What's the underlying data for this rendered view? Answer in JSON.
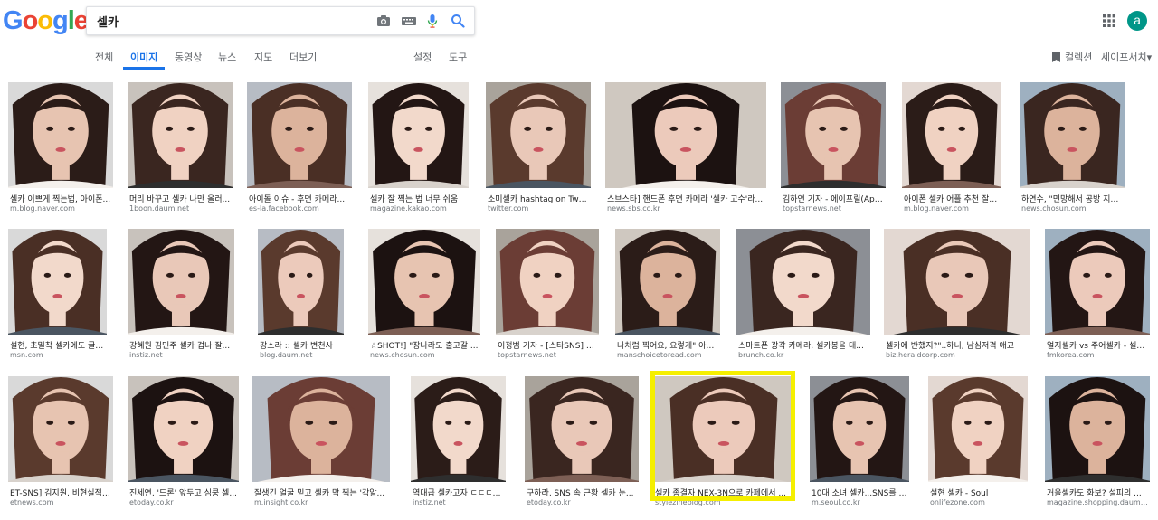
{
  "logo": {
    "letters": [
      "G",
      "o",
      "o",
      "g",
      "l",
      "e"
    ],
    "colors": [
      "#4285f4",
      "#ea4335",
      "#fbbc05",
      "#4285f4",
      "#34a853",
      "#ea4335"
    ]
  },
  "search": {
    "query": "셀카"
  },
  "tabs": [
    {
      "label": "전체",
      "active": false
    },
    {
      "label": "이미지",
      "active": true
    },
    {
      "label": "동영상",
      "active": false
    },
    {
      "label": "뉴스",
      "active": false
    },
    {
      "label": "지도",
      "active": false
    },
    {
      "label": "더보기",
      "active": false
    },
    {
      "label": "설정",
      "active": false
    },
    {
      "label": "도구",
      "active": false
    }
  ],
  "right": {
    "collections": "컬렉션",
    "safesearch": "세이프서치▾",
    "avatar": "a"
  },
  "accent": "#1a73e8",
  "results": [
    {
      "caption": "셀카 이쁘게 찍는법, 아이폰...",
      "source": "m.blog.naver.com"
    },
    {
      "caption": "머리 바꾸고 셀카 나만 올러...",
      "source": "1boon.daum.net"
    },
    {
      "caption": "아이돌 이슈 - 후면 카메라...",
      "source": "es-la.facebook.com"
    },
    {
      "caption": "셀카 잘 찍는 법 너무 쉬움",
      "source": "magazine.kakao.com"
    },
    {
      "caption": "소미셀카 hashtag on Twitter",
      "source": "twitter.com"
    },
    {
      "caption": "스브스타] 핸드폰 후면 카메라 '셀카 고수'라...",
      "source": "news.sbs.co.kr"
    },
    {
      "caption": "김하연 기자 - 에이프릴(Apr...",
      "source": "topstarnews.net"
    },
    {
      "caption": "아이폰 셀카 어플 추천 잘나...",
      "source": "m.blog.naver.com"
    },
    {
      "caption": "하연수, \"민망해서 공방 지운다\"...",
      "source": "news.chosun.com"
    },
    {
      "caption": "설현, 초밀착 셀카에도 굴욕...",
      "source": "msn.com"
    },
    {
      "caption": "강혜원 김민주 셀카 겁나 잘...",
      "source": "instiz.net"
    },
    {
      "caption": "강소라 :: 셀카 변천사",
      "source": "blog.daum.net"
    },
    {
      "caption": "☆SHOT!] \"장나라도 출고갈 ...",
      "source": "news.chosun.com"
    },
    {
      "caption": "이정범 기자 - [스타SNS] 하...",
      "source": "topstarnews.net"
    },
    {
      "caption": "나처럼 찍어요, 요렇게\" 아이...",
      "source": "manschoicetoread.com"
    },
    {
      "caption": "스마트폰 광각 카메라, 셀카봉을 대...",
      "source": "brunch.co.kr"
    },
    {
      "caption": "셀카에 반했지?\"..하니, 남심저격 애교",
      "source": "biz.heraldcorp.com"
    },
    {
      "caption": "얼지셀카 vs 주어셀카 - 셀카...",
      "source": "fmkorea.com"
    },
    {
      "caption": "ET-SNS] 김지원, 비현실적 ...",
      "source": "etnews.com"
    },
    {
      "caption": "진세연, '드론' 앞두고 심쿵 셀...",
      "source": "etoday.co.kr"
    },
    {
      "caption": "잘생긴 얼굴 믿고 셀카 막 찍는 '각알...",
      "source": "m.insight.co.kr"
    },
    {
      "caption": "역대급 셀카고자 ㄷㄷㄷㄷ...",
      "source": "instiz.net"
    },
    {
      "caption": "구하라, SNS 속 근황 셀카 눈...",
      "source": "etoday.co.kr"
    },
    {
      "caption": "셀카 종결자 NEX-3N으로 카페에서 ...",
      "source": "stylezineblog.com"
    },
    {
      "caption": "10대 소녀 셀카...SNS를 공...",
      "source": "m.seoul.co.kr"
    },
    {
      "caption": "설현 셀카 - Soul",
      "source": "onlifezone.com"
    },
    {
      "caption": "거울셀카도 화보? 설피의 ...",
      "source": "magazine.shopping.daum.net"
    }
  ]
}
